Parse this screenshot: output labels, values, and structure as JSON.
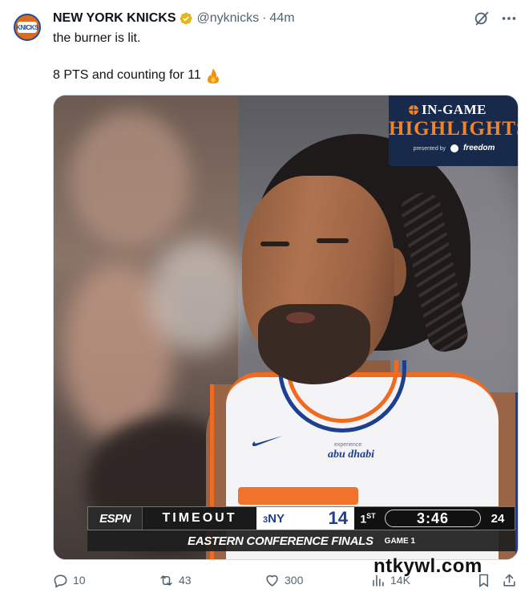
{
  "account": {
    "avatar_text": "KNICKS",
    "name": "NEW YORK KNICKS",
    "handle": "@nyknicks",
    "separator": "·",
    "time": "44m",
    "verified_icon": "verified-gold-badge-icon"
  },
  "tweet": {
    "text_line1": "the burner is lit.",
    "text_line2": "8 PTS and counting for 11"
  },
  "media": {
    "highlight_badge": {
      "line1": "IN-GAME",
      "line2": "HIGHLIGHTS",
      "presented_by": "presented by",
      "brand": "freedom"
    },
    "jersey_sponsor": "abu dhabi",
    "jersey_sponsor_small": "experience",
    "scorebug": {
      "network": "ESPN",
      "status": "TIMEOUT",
      "team_seed": "3",
      "team": "NY",
      "score": "14",
      "period": "1",
      "period_suffix": "ST",
      "clock": "3:46",
      "shot_clock": "24"
    },
    "subbug": {
      "series": "EASTERN CONFERENCE FINALS",
      "game": "GAME 1"
    }
  },
  "actions": {
    "replies": "10",
    "reposts": "43",
    "likes": "300",
    "views": "14K"
  },
  "watermark": "ntkywl.com",
  "colors": {
    "knicks_orange": "#f58426",
    "knicks_blue": "#1d3f8f",
    "muted_text": "#536471",
    "verified_gold": "#e2b719"
  }
}
